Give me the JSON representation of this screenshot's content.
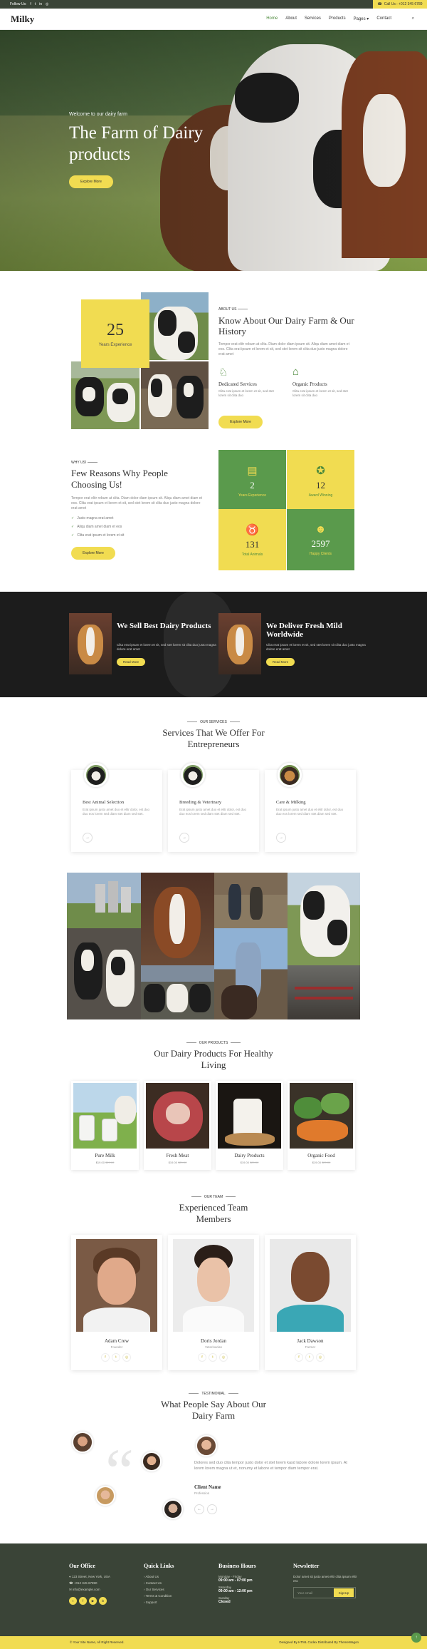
{
  "topbar": {
    "follow_label": "Follow Us:",
    "social_icons": [
      "facebook-icon",
      "twitter-icon",
      "linkedin-icon",
      "instagram-icon"
    ],
    "call_label": "Call Us : +012 345 6789"
  },
  "nav": {
    "logo": "Milky",
    "items": [
      "Home",
      "About",
      "Services",
      "Products",
      "Pages",
      "Contact"
    ],
    "active": "Home"
  },
  "hero": {
    "welcome": "Welcome to our dairy farm",
    "title": "The Farm of Dairy products",
    "button": "Explore More"
  },
  "about": {
    "years_number": "25",
    "years_label": "Years Experience",
    "subtitle": "ABOUT US",
    "title": "Know About Our Dairy Farm & Our History",
    "description": "Tempor erat elitr rebum at clita. Diam dolor diam ipsum sit. Aliqu diam amet diam et eos. Clita erat ipsum et lorem et sit, sed stet lorem sit clita duo justo magna dolore erat amet",
    "features": [
      {
        "title": "Dedicated Services",
        "desc": "Clita erat ipsum et lorem et sit, sed stet lorem sit clita duo",
        "icon": "cow-farmer-icon"
      },
      {
        "title": "Organic Products",
        "desc": "Clita erat ipsum et lorem et sit, sed stet lorem sit clita duo",
        "icon": "barn-icon"
      }
    ],
    "button": "Explore More"
  },
  "why": {
    "subtitle": "WHY US!",
    "title": "Few Reasons Why People Choosing Us!",
    "description": "Tempor erat elitr rebum at clita. Diam dolor diam ipsum sit. Aliqu diam amet diam et eos. Clita erat ipsum et lorem et sit, sed stet lorem sit clita duo justo magna dolore erat amet",
    "list": [
      "Justo magna erat amet",
      "Aliqu diam amet diam et eos",
      "Clita erat ipsum et lorem et sit"
    ],
    "button": "Explore More",
    "stats": [
      {
        "number": "2",
        "label": "Years Experience",
        "icon": "certificate-icon"
      },
      {
        "number": "12",
        "label": "Award Winning",
        "icon": "award-icon"
      },
      {
        "number": "131",
        "label": "Total Animals",
        "icon": "cow-icon"
      },
      {
        "number": "2597",
        "label": "Happy Clients",
        "icon": "users-icon"
      }
    ]
  },
  "banners": [
    {
      "title": "We Sell Best Dairy Products",
      "desc": "Clita erat ipsum et lorem et sit, sed stet lorem sit clita duo justo magna dolore erat amet",
      "button": "Read More"
    },
    {
      "title": "We Deliver Fresh Mild Worldwide",
      "desc": "Clita erat ipsum et lorem et sit, sed stet lorem sit clita duo justo magna dolore erat amet",
      "button": "Read More"
    }
  ],
  "services": {
    "subtitle": "OUR SERVICES",
    "title": "Services That We Offer For Entrepreneurs",
    "items": [
      {
        "title": "Best Animal Selection",
        "desc": "Erat ipsum justo amet duo et elitr dolor, est duo duo eos lorem sed diam stet diam sed stet."
      },
      {
        "title": "Breeding & Veterinary",
        "desc": "Erat ipsum justo amet duo et elitr dolor, est duo duo eos lorem sed diam stet diam sed stet."
      },
      {
        "title": "Care & Milking",
        "desc": "Erat ipsum justo amet duo et elitr dolor, est duo duo eos lorem sed diam stet diam sed stet."
      }
    ]
  },
  "products": {
    "subtitle": "OUR PRODUCTS",
    "title": "Our Dairy Products For Healthy Living",
    "items": [
      {
        "name": "Pure Milk",
        "price": "$19.00",
        "old": "$29.00"
      },
      {
        "name": "Fresh Meat",
        "price": "$19.00",
        "old": "$29.00"
      },
      {
        "name": "Dairy Products",
        "price": "$19.00",
        "old": "$29.00"
      },
      {
        "name": "Organic Food",
        "price": "$19.00",
        "old": "$29.00"
      }
    ]
  },
  "team": {
    "subtitle": "OUR TEAM",
    "title": "Experienced Team Members",
    "members": [
      {
        "name": "Adam Crew",
        "role": "Founder"
      },
      {
        "name": "Doris Jordan",
        "role": "Veterinarian"
      },
      {
        "name": "Jack Dawson",
        "role": "Farmer"
      }
    ]
  },
  "testimonial": {
    "subtitle": "TESTIMONIAL",
    "title": "What People Say About Our Dairy Farm",
    "text": "Dolores sed duo clita tempor justo dolor et stet lorem kasd labore dolore lorem ipsum. At lorem lorem magna ut et, nonumy et labore et tempor diam tempor erat.",
    "name": "Client Name",
    "role": "Profession"
  },
  "footer": {
    "office": {
      "title": "Our Office",
      "address": "123 Street, New York, USA",
      "phone": "+012 345 67890",
      "email": "info@example.com"
    },
    "links": {
      "title": "Quick Links",
      "items": [
        "About Us",
        "Contact Us",
        "Our Services",
        "Terms & Condition",
        "Support"
      ]
    },
    "hours": {
      "title": "Business Hours",
      "rows": [
        {
          "day": "Monday - Friday",
          "time": "09:00 am - 07:00 pm"
        },
        {
          "day": "Saturday",
          "time": "09:00 am - 12:00 pm"
        },
        {
          "day": "Sunday",
          "time": "Closed"
        }
      ]
    },
    "newsletter": {
      "title": "Newsletter",
      "desc": "Dolor amet sit justo amet elitr clita ipsum elitr est.",
      "placeholder": "Your email",
      "button": "SignUp"
    },
    "copyright": "© Your Site Name, All Right Reserved.",
    "credit": "Designed By HTML Codex Distributed By ThemeWagon"
  },
  "colors": {
    "yellow": "#f1dc51",
    "green": "#5a9a4c",
    "dark": "#3a4437"
  }
}
